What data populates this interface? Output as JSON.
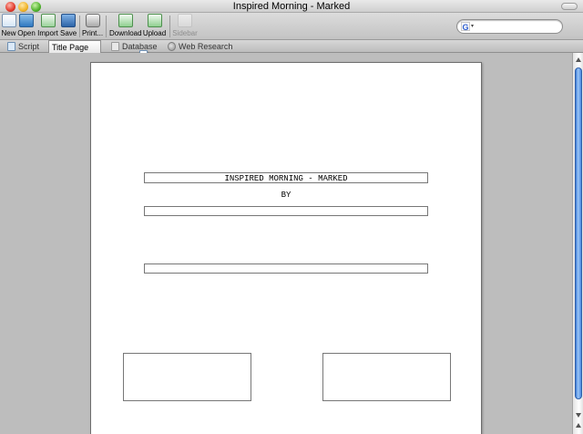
{
  "window": {
    "title": "Inspired Morning - Marked"
  },
  "toolbar": {
    "buttons": [
      {
        "label": "New",
        "icon": "new-document-icon"
      },
      {
        "label": "Open",
        "icon": "folder-open-icon"
      },
      {
        "label": "Import",
        "icon": "import-icon"
      },
      {
        "label": "Save",
        "icon": "save-disk-icon"
      },
      {
        "label": "Print...",
        "icon": "printer-icon"
      },
      {
        "label": "Download",
        "icon": "download-icon"
      },
      {
        "label": "Upload",
        "icon": "upload-icon"
      },
      {
        "label": "Sidebar",
        "icon": "sidebar-icon",
        "disabled": true
      }
    ],
    "search": {
      "engine_glyph": "G",
      "caret": "▾",
      "value": "",
      "placeholder": ""
    }
  },
  "tabs": [
    {
      "label": "Script",
      "icon": "script-tab-icon",
      "active": false
    },
    {
      "label": "Title Page",
      "icon": "title-page-tab-icon",
      "active": true
    },
    {
      "label": "Database",
      "icon": "database-tab-icon",
      "active": false
    },
    {
      "label": "Web Research",
      "icon": "globe-icon",
      "active": false
    }
  ],
  "title_page": {
    "title": "INSPIRED MORNING - MARKED",
    "by_label": "BY",
    "author": "",
    "based_on": "",
    "contact_left": "",
    "contact_right": ""
  }
}
